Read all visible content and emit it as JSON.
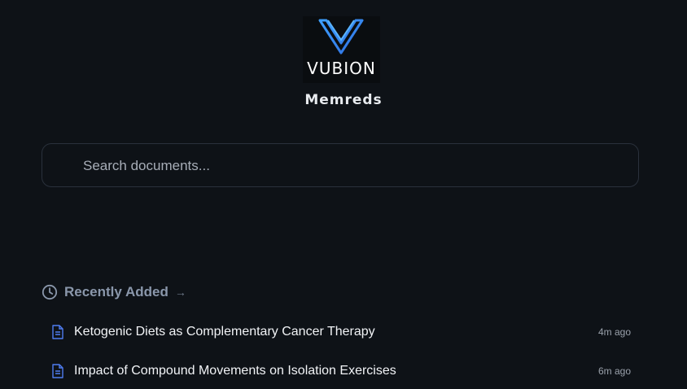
{
  "logo": {
    "text": "VUBION",
    "icon": "v-logo-icon"
  },
  "app": {
    "name": "Memreds"
  },
  "search": {
    "placeholder": "Search documents...",
    "value": ""
  },
  "recent": {
    "title": "Recently Added",
    "arrow": "→",
    "icon": "clock-icon",
    "items": [
      {
        "title": "Ketogenic Diets as Complementary Cancer Therapy",
        "time": "4m ago",
        "icon": "document-icon"
      },
      {
        "title": "Impact of Compound Movements on Isolation Exercises",
        "time": "6m ago",
        "icon": "document-icon"
      }
    ]
  },
  "colors": {
    "background": "#0e1217",
    "accent": "#4f7cf0",
    "muted_heading": "#8a97ab"
  }
}
